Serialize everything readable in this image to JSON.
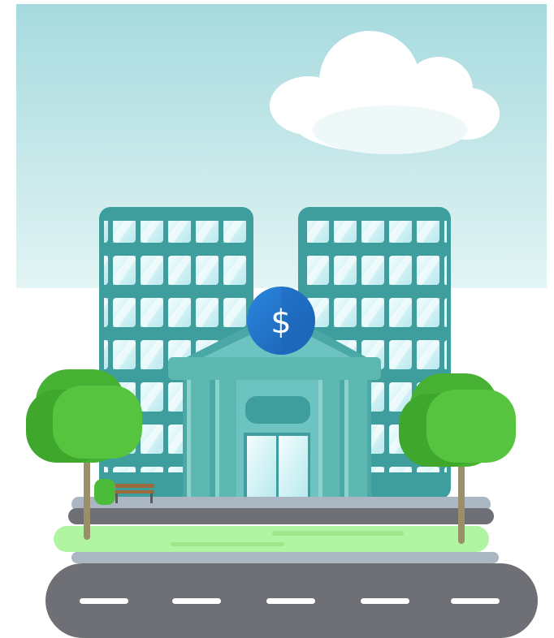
{
  "illustration": {
    "bank_sign": {
      "symbol": "$"
    },
    "colors": {
      "sky_top": "#a6dade",
      "sky_bottom": "#e3f4f4",
      "tower": "#3e9e9e",
      "window": "#d9f7fa",
      "bank": "#5db8b2",
      "coin": "#1f77d1",
      "tree": "#4dbb3a",
      "grass": "#b0f5a1",
      "road": "#6e7076",
      "lane_marking": "#ffffff"
    }
  }
}
